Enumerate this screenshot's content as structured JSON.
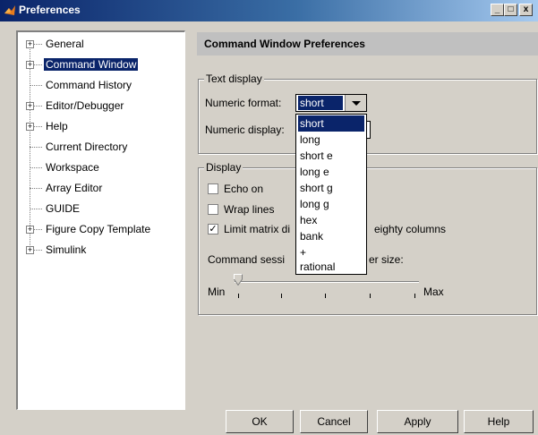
{
  "window": {
    "title": "Preferences",
    "minimize": "_",
    "maximize": "□",
    "close": "x"
  },
  "tree": {
    "items": [
      {
        "label": "General",
        "expandable": true
      },
      {
        "label": "Command Window",
        "expandable": true,
        "selected": true
      },
      {
        "label": "Command History",
        "expandable": false
      },
      {
        "label": "Editor/Debugger",
        "expandable": true
      },
      {
        "label": "Help",
        "expandable": true
      },
      {
        "label": "Current Directory",
        "expandable": false
      },
      {
        "label": "Workspace",
        "expandable": false
      },
      {
        "label": "Array Editor",
        "expandable": false
      },
      {
        "label": "GUIDE",
        "expandable": false
      },
      {
        "label": "Figure Copy Template",
        "expandable": true
      },
      {
        "label": "Simulink",
        "expandable": true
      }
    ]
  },
  "panel": {
    "header": "Command Window Preferences",
    "text_display": {
      "group_title": "Text display",
      "numeric_format_label": "Numeric format:",
      "numeric_format_value": "short",
      "numeric_display_label": "Numeric display:",
      "options": [
        "short",
        "long",
        "short e",
        "long e",
        "short g",
        "long g",
        "hex",
        "bank",
        "+",
        "rational"
      ]
    },
    "display": {
      "group_title": "Display",
      "echo_on": "Echo on",
      "wrap_lines": "Wrap lines",
      "limit_matrix_part1": "Limit matrix di",
      "limit_matrix_part2": "eighty columns",
      "buffer_part1": "Command sessi",
      "buffer_part2": "er size:",
      "slider_min": "Min",
      "slider_max": "Max",
      "checkbox_mark": "✓"
    }
  },
  "buttons": {
    "ok": "OK",
    "cancel": "Cancel",
    "apply": "Apply",
    "help": "Help"
  }
}
